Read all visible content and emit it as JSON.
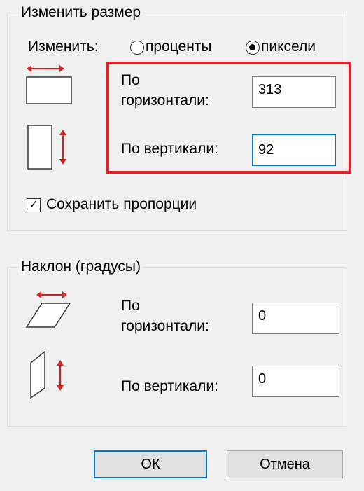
{
  "resize": {
    "title": "Изменить размер",
    "by_label": "Изменить:",
    "options": [
      "проценты",
      "пиксели"
    ],
    "selected": "пиксели",
    "horizontal_label_1": "По",
    "horizontal_label_2": "горизонтали:",
    "horizontal_value": "313",
    "vertical_label": "По вертикали:",
    "vertical_value": "92",
    "keep_ratio_label": "Сохранить пропорции",
    "keep_ratio_checked": true
  },
  "skew": {
    "title": "Наклон (градусы)",
    "horizontal_label_1": "По",
    "horizontal_label_2": "горизонтали:",
    "horizontal_value": "0",
    "vertical_label": "По вертикали:",
    "vertical_value": "0"
  },
  "buttons": {
    "ok": "ОК",
    "cancel": "Отмена"
  },
  "colors": {
    "highlight": "#e0202a",
    "arrow": "#d42020",
    "focus": "#0078d7"
  }
}
